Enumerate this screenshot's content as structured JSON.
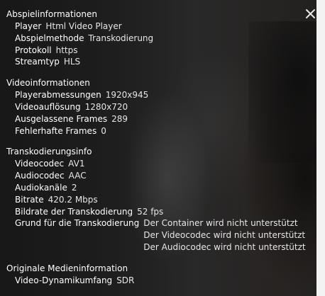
{
  "close_icon": "close-icon",
  "sections": [
    {
      "title": "Abspielinformationen",
      "rows": [
        {
          "label": "Player",
          "value": "Html Video Player"
        },
        {
          "label": "Abspielmethode",
          "value": "Transkodierung"
        },
        {
          "label": "Protokoll",
          "value": "https"
        },
        {
          "label": "Streamtyp",
          "value": "HLS"
        }
      ]
    },
    {
      "title": "Videoinformationen",
      "rows": [
        {
          "label": "Playerabmessungen",
          "value": "1920x945"
        },
        {
          "label": "Videoauflösung",
          "value": "1280x720"
        },
        {
          "label": "Ausgelassene Frames",
          "value": "289"
        },
        {
          "label": "Fehlerhafte Frames",
          "value": "0"
        }
      ]
    },
    {
      "title": "Transkodierungsinfo",
      "rows": [
        {
          "label": "Videocodec",
          "value": "AV1"
        },
        {
          "label": "Audiocodec",
          "value": "AAC"
        },
        {
          "label": "Audiokanäle",
          "value": "2"
        },
        {
          "label": "Bitrate",
          "value": "420.2 Mbps"
        },
        {
          "label": "Bildrate der Transkodierung",
          "value": "52 fps"
        }
      ],
      "multi": {
        "label": "Grund für die Transkodierung",
        "values": [
          "Der Container wird nicht unterstützt",
          "Der Videocodec wird nicht unterstützt",
          "Der Audiocodec wird nicht unterstützt"
        ]
      }
    },
    {
      "title": "Originale Medieninformation",
      "rows": [
        {
          "label": "Video-Dynamikumfang",
          "value": "SDR"
        }
      ]
    }
  ]
}
